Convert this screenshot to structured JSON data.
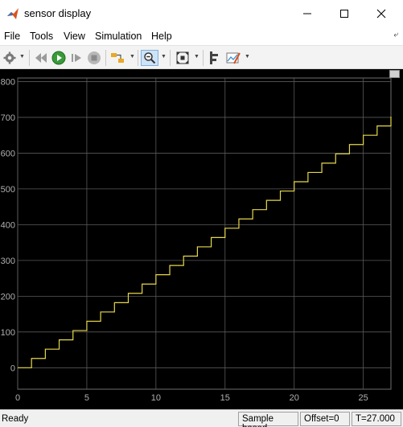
{
  "window": {
    "title": "sensor display",
    "icon": "matlab-icon",
    "minimize_icon": "minimize-icon",
    "maximize_icon": "maximize-icon",
    "close_icon": "close-icon"
  },
  "menu": {
    "items": [
      "File",
      "Tools",
      "View",
      "Simulation",
      "Help"
    ],
    "overflow_icon": "toolbar-menu-arrow-icon"
  },
  "toolbar": {
    "icons": [
      "settings-icon",
      "step-back-icon",
      "run-icon",
      "step-forward-icon",
      "stop-icon",
      "highlight-block-icon",
      "zoom-icon",
      "autoscale-icon",
      "cursor-measurements-icon",
      "style-icon"
    ],
    "zoom_active": true
  },
  "chart_data": {
    "type": "line",
    "title": "",
    "xlabel": "",
    "ylabel": "",
    "xlim": [
      0,
      27
    ],
    "ylim": [
      -60,
      810
    ],
    "xticks": [
      0,
      5,
      10,
      15,
      20,
      25
    ],
    "yticks": [
      0,
      100,
      200,
      300,
      400,
      500,
      600,
      700,
      800
    ],
    "grid": true,
    "background": "#000000",
    "grid_color": "#5a5a5a",
    "tick_color": "#b0b0b0",
    "series": [
      {
        "style": "stairs",
        "color": "#e6d84a",
        "x": [
          0,
          1,
          2,
          3,
          4,
          5,
          6,
          7,
          8,
          9,
          10,
          11,
          12,
          13,
          14,
          15,
          16,
          17,
          18,
          19,
          20,
          21,
          22,
          23,
          24,
          25,
          26,
          27
        ],
        "y": [
          0,
          26,
          52,
          78,
          104,
          130,
          156,
          182,
          208,
          234,
          260,
          286,
          312,
          338,
          364,
          390,
          416,
          442,
          468,
          494,
          520,
          546,
          572,
          598,
          624,
          650,
          676,
          702
        ]
      }
    ]
  },
  "status": {
    "ready": "Ready",
    "mode": "Sample based",
    "offset": "Offset=0",
    "time": "T=27.000"
  }
}
